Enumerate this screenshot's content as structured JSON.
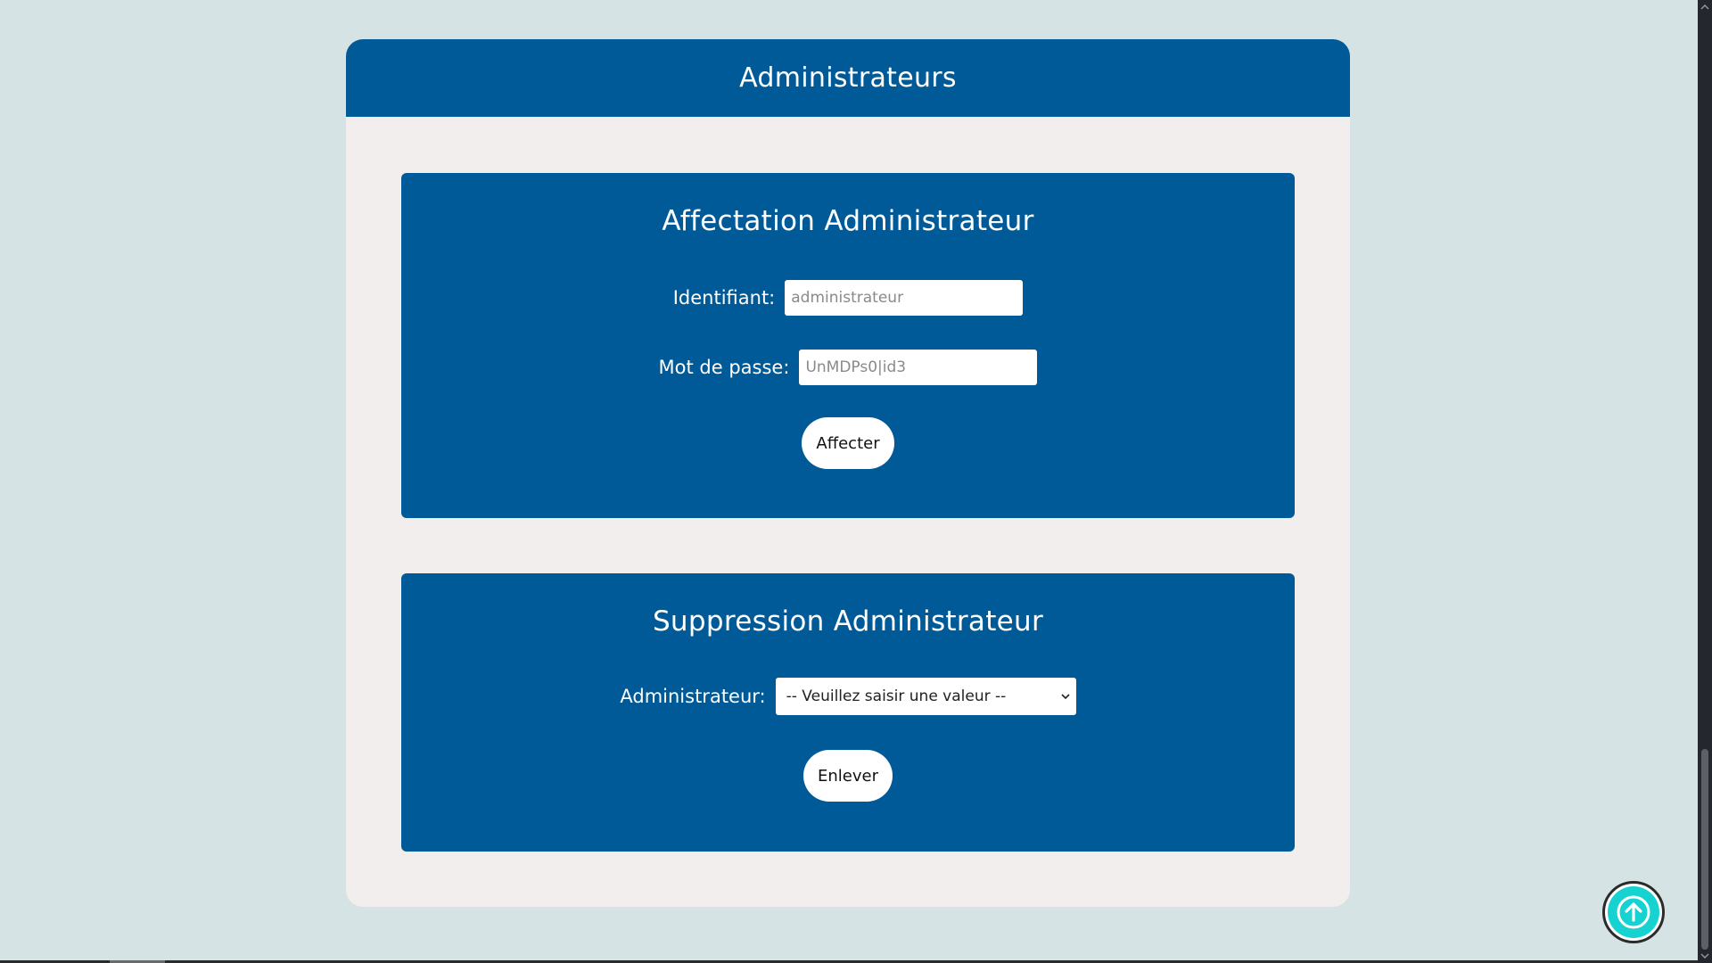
{
  "header": {
    "title": "Administrateurs"
  },
  "assign_panel": {
    "title": "Affectation Administrateur",
    "identifier_label": "Identifiant:",
    "identifier_placeholder": "administrateur",
    "identifier_value": "",
    "password_label": "Mot de passe:",
    "password_placeholder": "UnMDPs0|id3",
    "password_value": "",
    "submit_label": "Affecter"
  },
  "remove_panel": {
    "title": "Suppression Administrateur",
    "admin_label": "Administrateur:",
    "admin_selected": "-- Veuillez saisir une valeur --",
    "submit_label": "Enlever"
  },
  "icons": {
    "scroll_top": "arrow-up-circle-icon",
    "select_chevron": "chevron-down-icon"
  },
  "colors": {
    "background": "#d5e3e4",
    "card": "#f1eeed",
    "primary": "#005a98",
    "accent": "#16d3d1"
  }
}
